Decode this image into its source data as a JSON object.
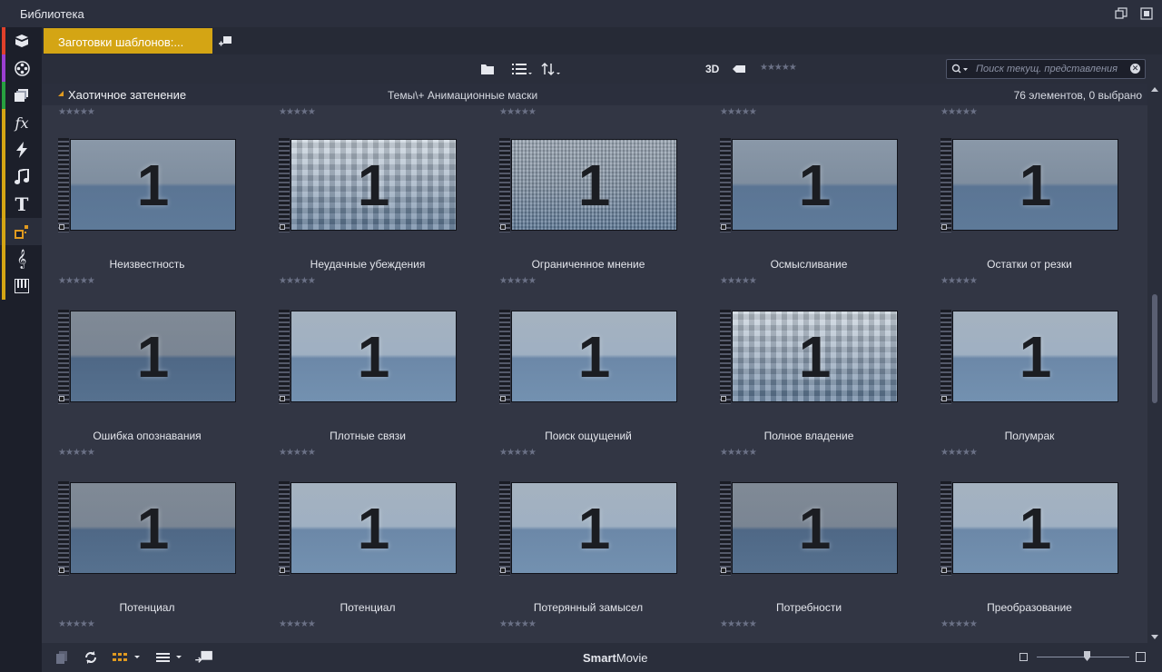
{
  "window": {
    "title": "Библиотека",
    "icons": [
      "restore-window-icon",
      "detach-window-icon"
    ]
  },
  "sidebar": {
    "items": [
      {
        "name": "project-bin",
        "icon": "box-icon",
        "color": "#e0402a"
      },
      {
        "name": "media",
        "icon": "film-reel-icon",
        "color": "#9b3fd0"
      },
      {
        "name": "disc-projects",
        "icon": "stack-icon",
        "color": "#27a040"
      },
      {
        "name": "effects",
        "icon": "fx-icon",
        "color": "#d4a514"
      },
      {
        "name": "transitions",
        "icon": "lightning-icon",
        "color": "#d4a514"
      },
      {
        "name": "audio",
        "icon": "music-note-icon",
        "color": "#d4a514"
      },
      {
        "name": "titles",
        "icon": "text-t-icon",
        "color": "#d4a514"
      },
      {
        "name": "montage-themes",
        "icon": "themes-icon",
        "color": "#d4a514",
        "active": true
      },
      {
        "name": "sound-effects",
        "icon": "treble-clef-icon",
        "color": "#d4a514"
      },
      {
        "name": "music",
        "icon": "piano-icon",
        "color": "#d4a514"
      }
    ]
  },
  "tabs": {
    "active_label": "Заготовки шаблонов:...",
    "accent": "#d4a514"
  },
  "toolbar": {
    "three_d": "3D",
    "stars": "★★★★★",
    "search_placeholder": "Поиск текущ. представления"
  },
  "section": {
    "name": "Хаотичное затенение",
    "path": "Темы\\+ Анимационные маски",
    "count": "76 элементов, 0 выбрано"
  },
  "rating_stars": "★★★★★",
  "items": [
    {
      "label": "Неизвестность",
      "style": "t-a"
    },
    {
      "label": "Неудачные убеждения",
      "style": "t-pix"
    },
    {
      "label": "Ограниченное мнение",
      "style": "t-fine"
    },
    {
      "label": "Осмысливание",
      "style": "t-a"
    },
    {
      "label": "Остатки от резки",
      "style": "t-a"
    },
    {
      "label": "Ошибка опознавания",
      "style": "t-c"
    },
    {
      "label": "Плотные связи",
      "style": "t-b"
    },
    {
      "label": "Поиск ощущений",
      "style": "t-b"
    },
    {
      "label": "Полное владение",
      "style": "t-pix"
    },
    {
      "label": "Полумрак",
      "style": "t-b"
    },
    {
      "label": "Потенциал",
      "style": "t-c"
    },
    {
      "label": "Потенциал",
      "style": "t-b"
    },
    {
      "label": "Потерянный замысел",
      "style": "t-b"
    },
    {
      "label": "Потребности",
      "style": "t-c"
    },
    {
      "label": "Преобразование",
      "style": "t-b"
    }
  ],
  "thumbnail_digit": "1",
  "bottombar": {
    "smart": "Smart",
    "movie": "Movie"
  }
}
